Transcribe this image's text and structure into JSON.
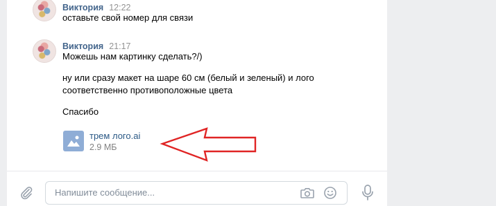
{
  "messages": [
    {
      "author": "Виктория",
      "time": "12:22",
      "text": "оставьте свой номер для связи"
    },
    {
      "author": "Виктория",
      "time": "21:17",
      "lines": [
        "Можешь нам картинку сделать?/)",
        "ну или сразу макет на шаре 60 см (белый и зеленый) и лого",
        "соответственно противоположные цвета",
        "Спасибо"
      ],
      "attachment": {
        "name": "трем лого.ai",
        "size": "2.9 МБ"
      }
    }
  ],
  "composer": {
    "placeholder": "Напишите сообщение..."
  },
  "icons": {
    "attach": "paperclip-icon",
    "camera": "camera-icon",
    "emoji": "smile-icon",
    "mic": "microphone-icon",
    "doc": "image-doc-icon",
    "arrow": "red-arrow-annotation-icon"
  },
  "colors": {
    "author": "#42648b",
    "link": "#2a5885",
    "arrow": "#e02424"
  }
}
